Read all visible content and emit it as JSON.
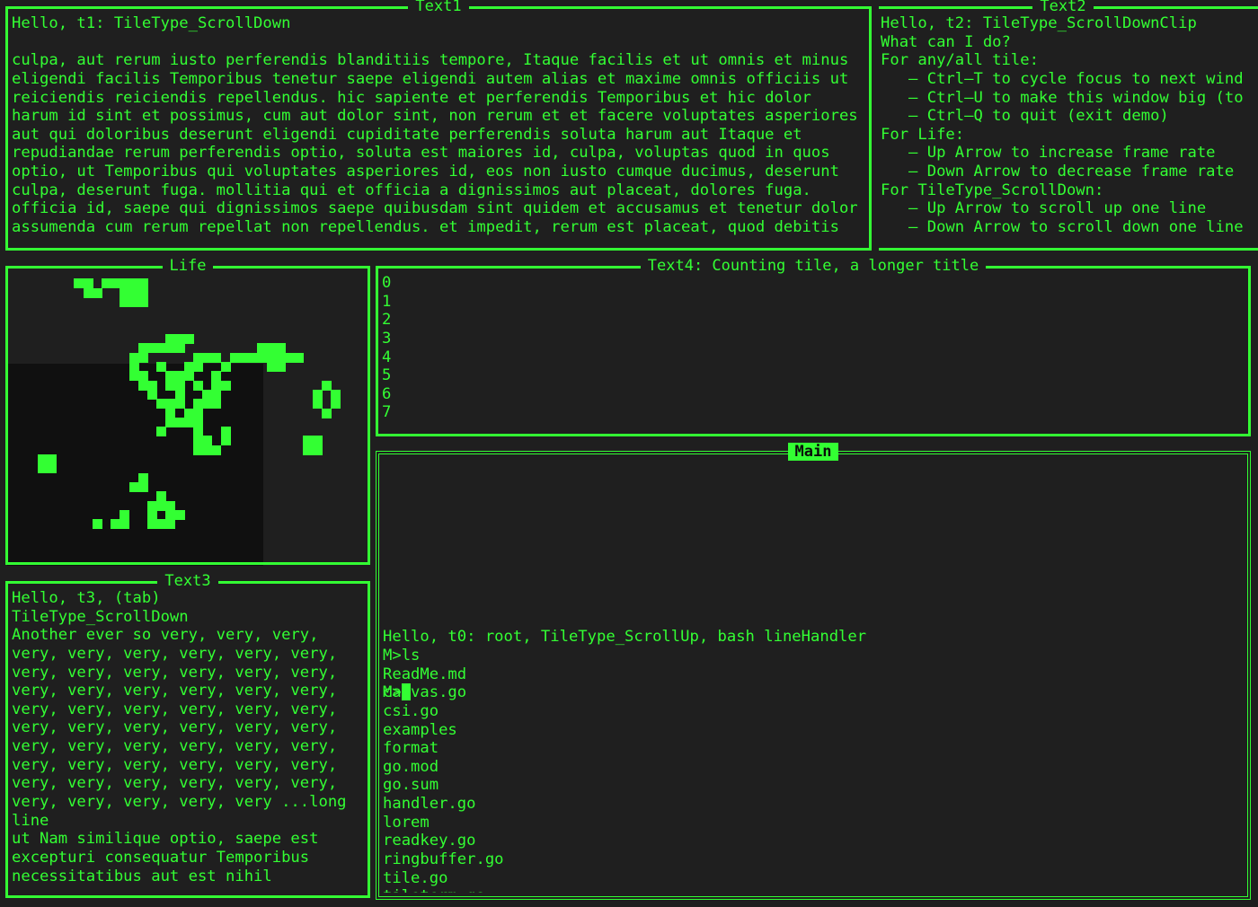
{
  "colors": {
    "accent": "#33ff33",
    "background": "#1f1f1f",
    "title_inverse_text": "#0b0b0b"
  },
  "text1": {
    "title": "Text1",
    "lines": [
      "Hello, t1: TileType_ScrollDown",
      "",
      "culpa, aut rerum iusto perferendis blanditiis tempore, Itaque facilis et ut omnis et minus",
      "eligendi facilis Temporibus tenetur saepe eligendi autem alias et maxime omnis officiis ut",
      "reiciendis reiciendis repellendus. hic sapiente et perferendis Temporibus et hic dolor",
      "harum id sint et possimus, cum aut dolor sint, non rerum et et facere voluptates asperiores",
      "aut qui doloribus deserunt eligendi cupiditate perferendis soluta harum aut Itaque et",
      "repudiandae rerum perferendis optio, soluta est maiores id, culpa, voluptas quod in quos",
      "optio, ut Temporibus qui voluptates asperiores id, eos non iusto cumque ducimus, deserunt",
      "culpa, deserunt fuga. mollitia qui et officia a dignissimos aut placeat, dolores fuga.",
      "officia id, saepe qui dignissimos saepe quibusdam sint quidem et accusamus et tenetur dolor",
      "assumenda cum rerum repellat non repellendus. et impedit, rerum est placeat, quod debitis"
    ]
  },
  "text2": {
    "title": "Text2",
    "lines": [
      "Hello, t2: TileType_ScrollDownClip",
      "What can I do?",
      "For any/all tile:",
      "   – Ctrl–T to cycle focus to next wind",
      "   – Ctrl–U to make this window big (to",
      "   – Ctrl–Q to quit (exit demo)",
      "For Life:",
      "   – Up Arrow to increase frame rate",
      "   – Down Arrow to decrease frame rate",
      "For TileType_ScrollDown:",
      "   – Up Arrow to scroll up one line",
      "   – Down Arrow to scroll down one line"
    ]
  },
  "life": {
    "title": "Life",
    "cells": [
      [
        7,
        1
      ],
      [
        8,
        1
      ],
      [
        10,
        1
      ],
      [
        11,
        1
      ],
      [
        12,
        1
      ],
      [
        13,
        1
      ],
      [
        14,
        1
      ],
      [
        8,
        2
      ],
      [
        9,
        2
      ],
      [
        12,
        2
      ],
      [
        13,
        2
      ],
      [
        14,
        2
      ],
      [
        12,
        3
      ],
      [
        13,
        3
      ],
      [
        14,
        3
      ],
      [
        17,
        7
      ],
      [
        18,
        7
      ],
      [
        19,
        7
      ],
      [
        14,
        8
      ],
      [
        15,
        8
      ],
      [
        16,
        8
      ],
      [
        17,
        8
      ],
      [
        18,
        8
      ],
      [
        27,
        8
      ],
      [
        28,
        8
      ],
      [
        29,
        8
      ],
      [
        13,
        9
      ],
      [
        14,
        9
      ],
      [
        20,
        9
      ],
      [
        21,
        9
      ],
      [
        22,
        9
      ],
      [
        24,
        9
      ],
      [
        25,
        9
      ],
      [
        26,
        9
      ],
      [
        27,
        9
      ],
      [
        28,
        9
      ],
      [
        29,
        9
      ],
      [
        30,
        9
      ],
      [
        31,
        9
      ],
      [
        13,
        10
      ],
      [
        16,
        10
      ],
      [
        19,
        10
      ],
      [
        20,
        10
      ],
      [
        23,
        10
      ],
      [
        28,
        10
      ],
      [
        29,
        10
      ],
      [
        13,
        11
      ],
      [
        14,
        11
      ],
      [
        17,
        11
      ],
      [
        18,
        11
      ],
      [
        19,
        11
      ],
      [
        22,
        11
      ],
      [
        14,
        12
      ],
      [
        15,
        12
      ],
      [
        17,
        12
      ],
      [
        18,
        12
      ],
      [
        20,
        12
      ],
      [
        22,
        12
      ],
      [
        23,
        12
      ],
      [
        34,
        12
      ],
      [
        15,
        13
      ],
      [
        18,
        13
      ],
      [
        21,
        13
      ],
      [
        22,
        13
      ],
      [
        33,
        13
      ],
      [
        35,
        13
      ],
      [
        16,
        14
      ],
      [
        17,
        14
      ],
      [
        18,
        14
      ],
      [
        20,
        14
      ],
      [
        21,
        14
      ],
      [
        22,
        14
      ],
      [
        33,
        14
      ],
      [
        35,
        14
      ],
      [
        17,
        15
      ],
      [
        19,
        15
      ],
      [
        20,
        15
      ],
      [
        34,
        15
      ],
      [
        17,
        16
      ],
      [
        18,
        16
      ],
      [
        19,
        16
      ],
      [
        20,
        16
      ],
      [
        16,
        17
      ],
      [
        20,
        17
      ],
      [
        23,
        17
      ],
      [
        20,
        18
      ],
      [
        21,
        18
      ],
      [
        23,
        18
      ],
      [
        32,
        18
      ],
      [
        33,
        18
      ],
      [
        20,
        19
      ],
      [
        21,
        19
      ],
      [
        22,
        19
      ],
      [
        32,
        19
      ],
      [
        33,
        19
      ],
      [
        3,
        20
      ],
      [
        4,
        20
      ],
      [
        3,
        21
      ],
      [
        4,
        21
      ],
      [
        14,
        22
      ],
      [
        13,
        23
      ],
      [
        14,
        23
      ],
      [
        16,
        24
      ],
      [
        15,
        25
      ],
      [
        16,
        25
      ],
      [
        17,
        25
      ],
      [
        12,
        26
      ],
      [
        15,
        26
      ],
      [
        17,
        26
      ],
      [
        18,
        26
      ],
      [
        9,
        27
      ],
      [
        11,
        27
      ],
      [
        12,
        27
      ],
      [
        15,
        27
      ],
      [
        16,
        27
      ],
      [
        17,
        27
      ]
    ]
  },
  "text4": {
    "title": "Text4: Counting tile, a longer title",
    "lines": [
      "0",
      "1",
      "2",
      "3",
      "4",
      "5",
      "6",
      "7"
    ]
  },
  "text3": {
    "title": "Text3",
    "lines": [
      "Hello, t3, (tab)",
      "TileType_ScrollDown",
      "Another ever so very, very, very,",
      "very, very, very, very, very, very,",
      "very, very, very, very, very, very,",
      "very, very, very, very, very, very,",
      "very, very, very, very, very, very,",
      "very, very, very, very, very, very,",
      "very, very, very, very, very, very,",
      "very, very, very, very, very, very,",
      "very, very, very, very, very, very,",
      "very, very, very, very, very ...long",
      "line",
      "ut Nam similique optio, saepe est",
      "excepturi consequatur Temporibus",
      "necessitatibus aut est nihil"
    ]
  },
  "main": {
    "title": "Main",
    "lines": [
      "Hello, t0: root, TileType_ScrollUp, bash lineHandler",
      "M>ls",
      "ReadMe.md",
      "canvas.go",
      "csi.go",
      "examples",
      "format",
      "go.mod",
      "go.sum",
      "handler.go",
      "lorem",
      "readkey.go",
      "ringbuffer.go",
      "tile.go",
      "tileterm.go"
    ],
    "prompt": "M>"
  }
}
